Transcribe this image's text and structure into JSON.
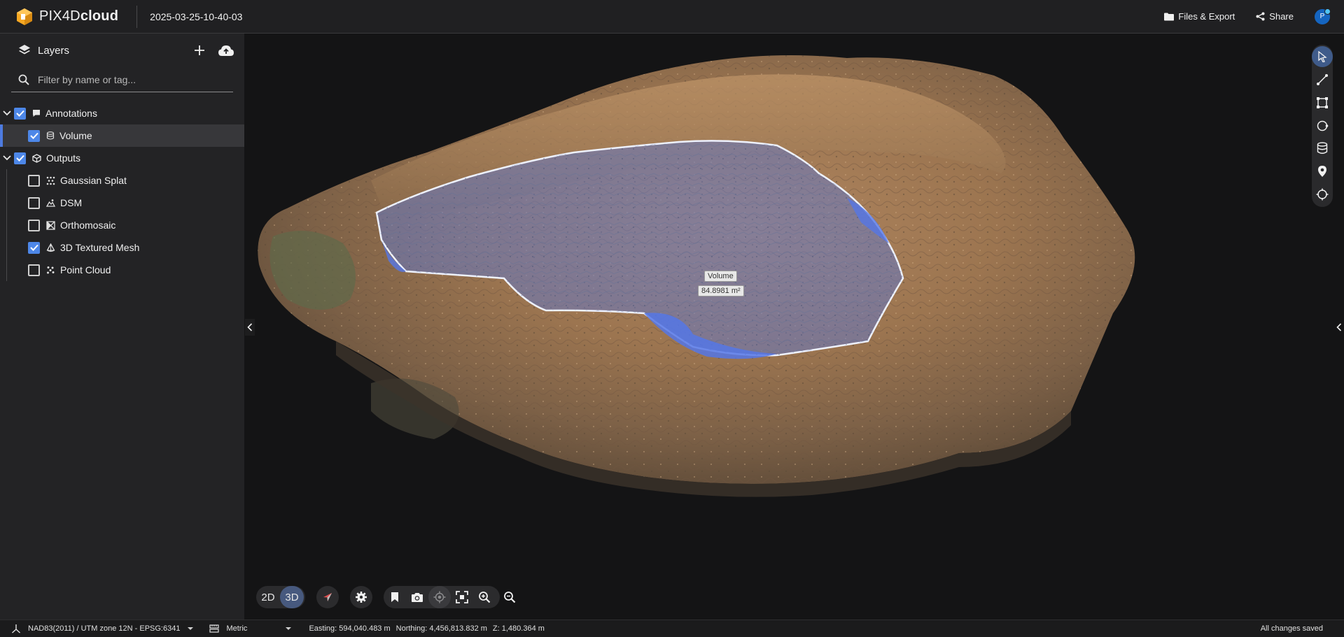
{
  "app": {
    "brand_plain": "PIX4D",
    "brand_bold": "cloud"
  },
  "header": {
    "project_title": "2025-03-25-10-40-03",
    "files_export_label": "Files & Export",
    "share_label": "Share",
    "avatar_initial": "P"
  },
  "sidebar": {
    "title": "Layers",
    "filter_placeholder": "Filter by name or tag...",
    "groups": [
      {
        "label": "Annotations",
        "checked": true,
        "expanded": true,
        "icon": "comment-icon",
        "items": [
          {
            "label": "Volume",
            "checked": true,
            "selected": true,
            "icon": "cylinder-icon"
          }
        ]
      },
      {
        "label": "Outputs",
        "checked": true,
        "expanded": true,
        "icon": "cube-icon",
        "items": [
          {
            "label": "Gaussian Splat",
            "checked": false,
            "icon": "splat-icon"
          },
          {
            "label": "DSM",
            "checked": false,
            "icon": "dsm-icon"
          },
          {
            "label": "Orthomosaic",
            "checked": false,
            "icon": "orthomosaic-icon"
          },
          {
            "label": "3D Textured Mesh",
            "checked": true,
            "icon": "mesh-icon"
          },
          {
            "label": "Point Cloud",
            "checked": false,
            "icon": "point-cloud-icon"
          }
        ]
      }
    ]
  },
  "viewport": {
    "annotation_name": "Volume",
    "annotation_value": "84.8981 m²",
    "view_modes": [
      "2D",
      "3D"
    ],
    "active_view_mode": "3D"
  },
  "statusbar": {
    "crs": "NAD83(2011) / UTM zone 12N - EPSG:6341",
    "units": "Metric",
    "easting": "Easting: 594,040.483 m",
    "northing": "Northing: 4,456,813.832 m",
    "z": "Z: 1,480.364 m",
    "save_status": "All changes saved"
  },
  "colors": {
    "accent": "#4d87e8",
    "selection_fill": "#5a78d8",
    "brand_orange": "#f7a823"
  }
}
